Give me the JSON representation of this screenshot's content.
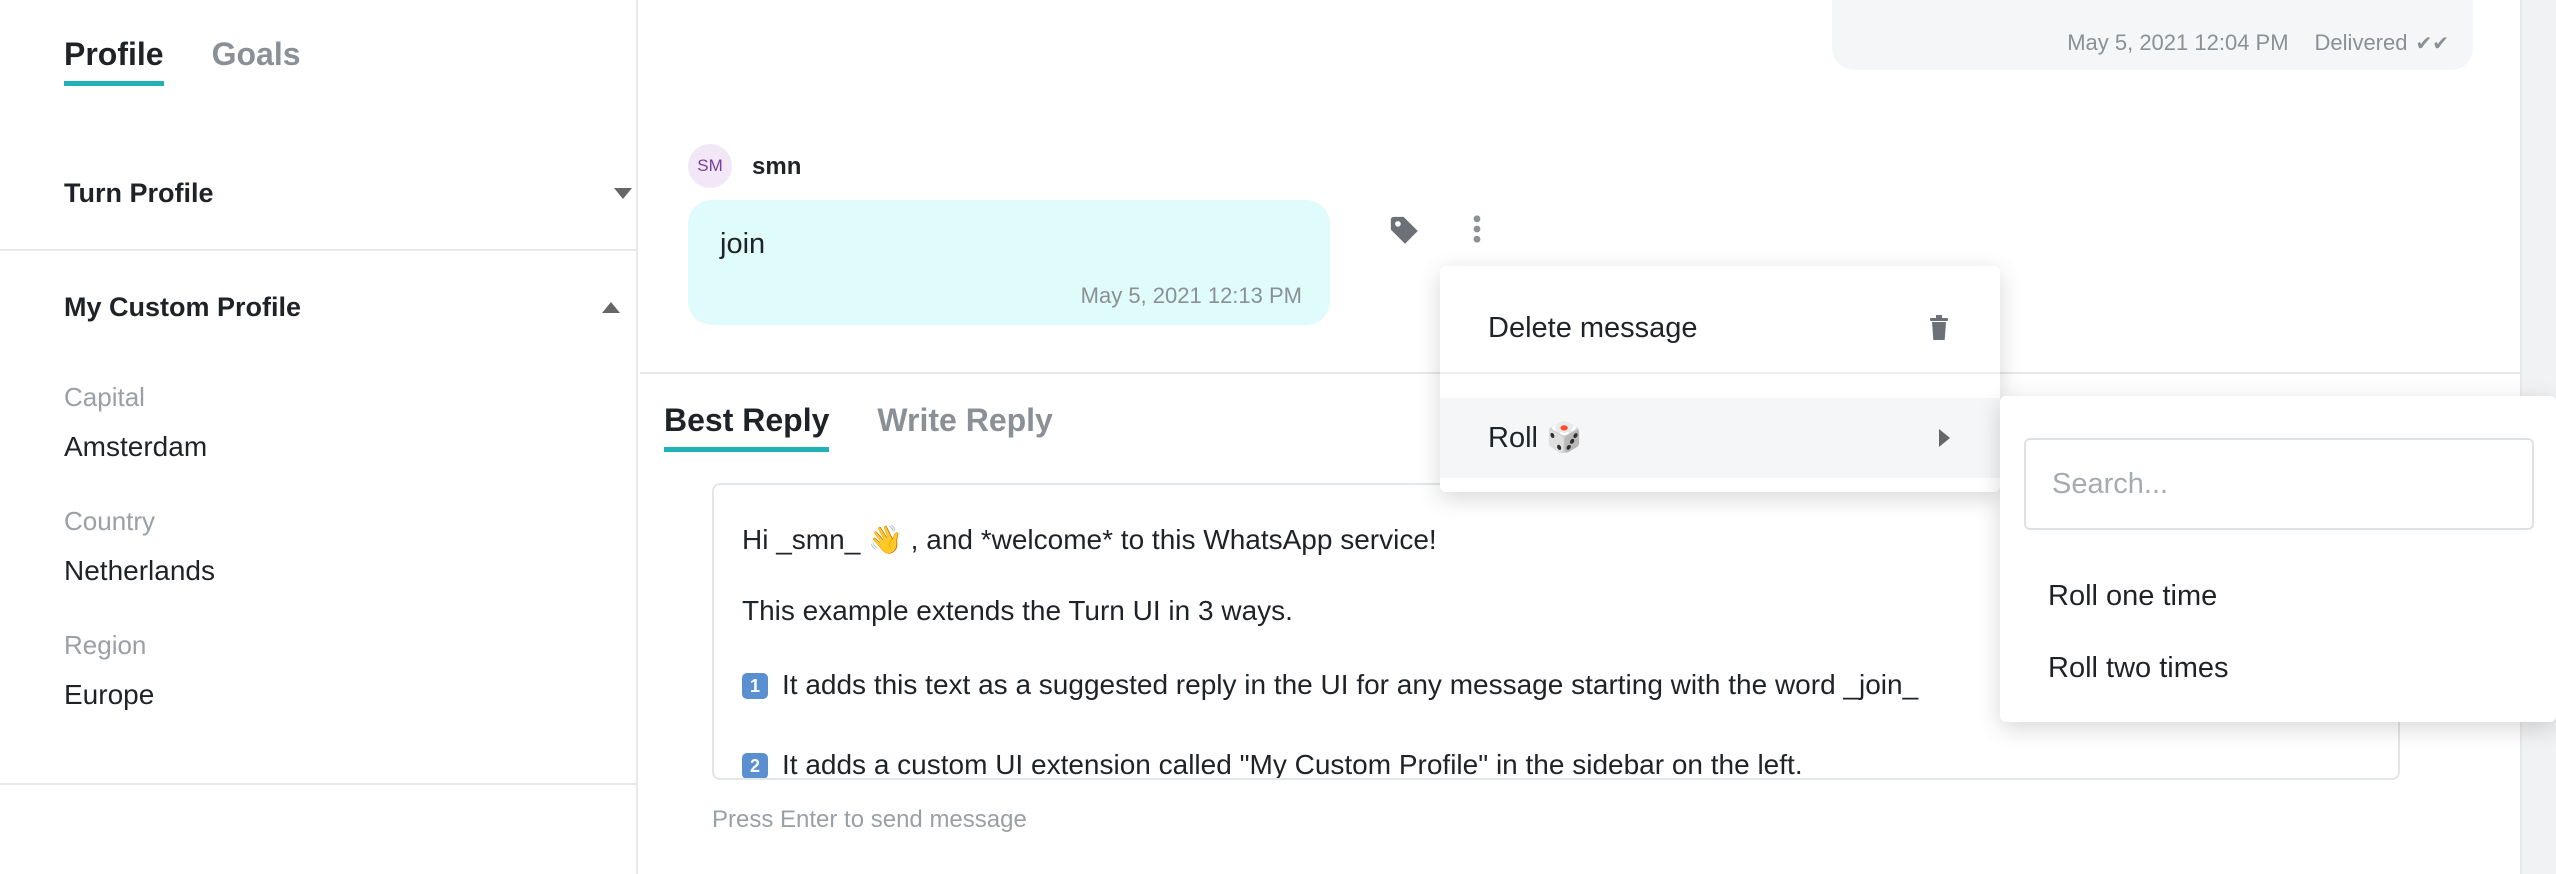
{
  "sidebar": {
    "tabs": [
      "Profile",
      "Goals"
    ],
    "turn_profile": "Turn Profile",
    "custom_profile": {
      "title": "My Custom Profile",
      "fields": [
        {
          "label": "Capital",
          "value": "Amsterdam"
        },
        {
          "label": "Country",
          "value": "Netherlands"
        },
        {
          "label": "Region",
          "value": "Europe"
        }
      ]
    }
  },
  "outgoing": {
    "timestamp": "May 5, 2021 12:04 PM",
    "status": "Delivered"
  },
  "incoming": {
    "avatar_initials": "SM",
    "sender": "smn",
    "text": "join",
    "timestamp": "May 5, 2021 12:13 PM"
  },
  "reply": {
    "tabs": [
      "Best Reply",
      "Write Reply"
    ],
    "lines": [
      "Hi _smn_ 👋 , and *welcome* to this WhatsApp service!",
      "This example extends the Turn UI in 3 ways.",
      "It adds this text as a suggested reply in the UI for any message starting with the word _join_",
      "It adds a custom UI extension called \"My Custom Profile\" in the sidebar on the left."
    ],
    "line_numbers": [
      "1",
      "2"
    ],
    "hint": "Press Enter to send message"
  },
  "menu": {
    "delete_label": "Delete message",
    "roll_label": "Roll 🎲"
  },
  "submenu": {
    "search_placeholder": "Search...",
    "items": [
      "Roll one time",
      "Roll two times"
    ]
  },
  "colors": {
    "accent": "#1fb3b7",
    "incoming_bubble": "#e0fbfc",
    "outgoing_bubble": "#f4f6f7"
  }
}
